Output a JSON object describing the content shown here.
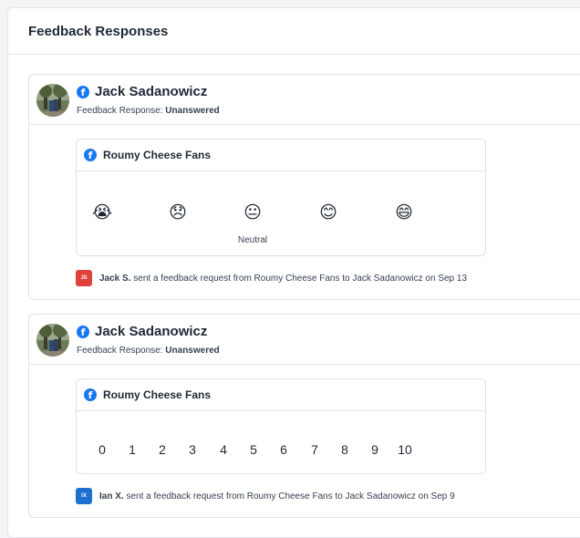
{
  "panel": {
    "title": "Feedback Responses"
  },
  "colors": {
    "facebook": "#1877f2",
    "badge_js": "#e0413d",
    "badge_ix": "#1e6fd0"
  },
  "cards": [
    {
      "name": "Jack Sadanowicz",
      "status_label": "Feedback Response:",
      "status_value": "Unanswered",
      "inner_title": "Roumy Cheese Fans",
      "type": "emoji",
      "emojis": [
        "crying-face",
        "disappointed-face",
        "neutral-face",
        "smiling-face",
        "happy-face"
      ],
      "neutral_label": "Neutral",
      "footer_badge": "JS",
      "footer_sender": "Jack S.",
      "footer_text": "sent a feedback request from Roumy Cheese Fans to Jack Sadanowicz on Sep 13"
    },
    {
      "name": "Jack Sadanowicz",
      "status_label": "Feedback Response:",
      "status_value": "Unanswered",
      "inner_title": "Roumy Cheese Fans",
      "type": "nps",
      "scale": [
        "0",
        "1",
        "2",
        "3",
        "4",
        "5",
        "6",
        "7",
        "8",
        "9",
        "10"
      ],
      "footer_badge": "IX",
      "footer_sender": "Ian X.",
      "footer_text": "sent a feedback request from Roumy Cheese Fans to Jack Sadanowicz on Sep 9"
    }
  ]
}
